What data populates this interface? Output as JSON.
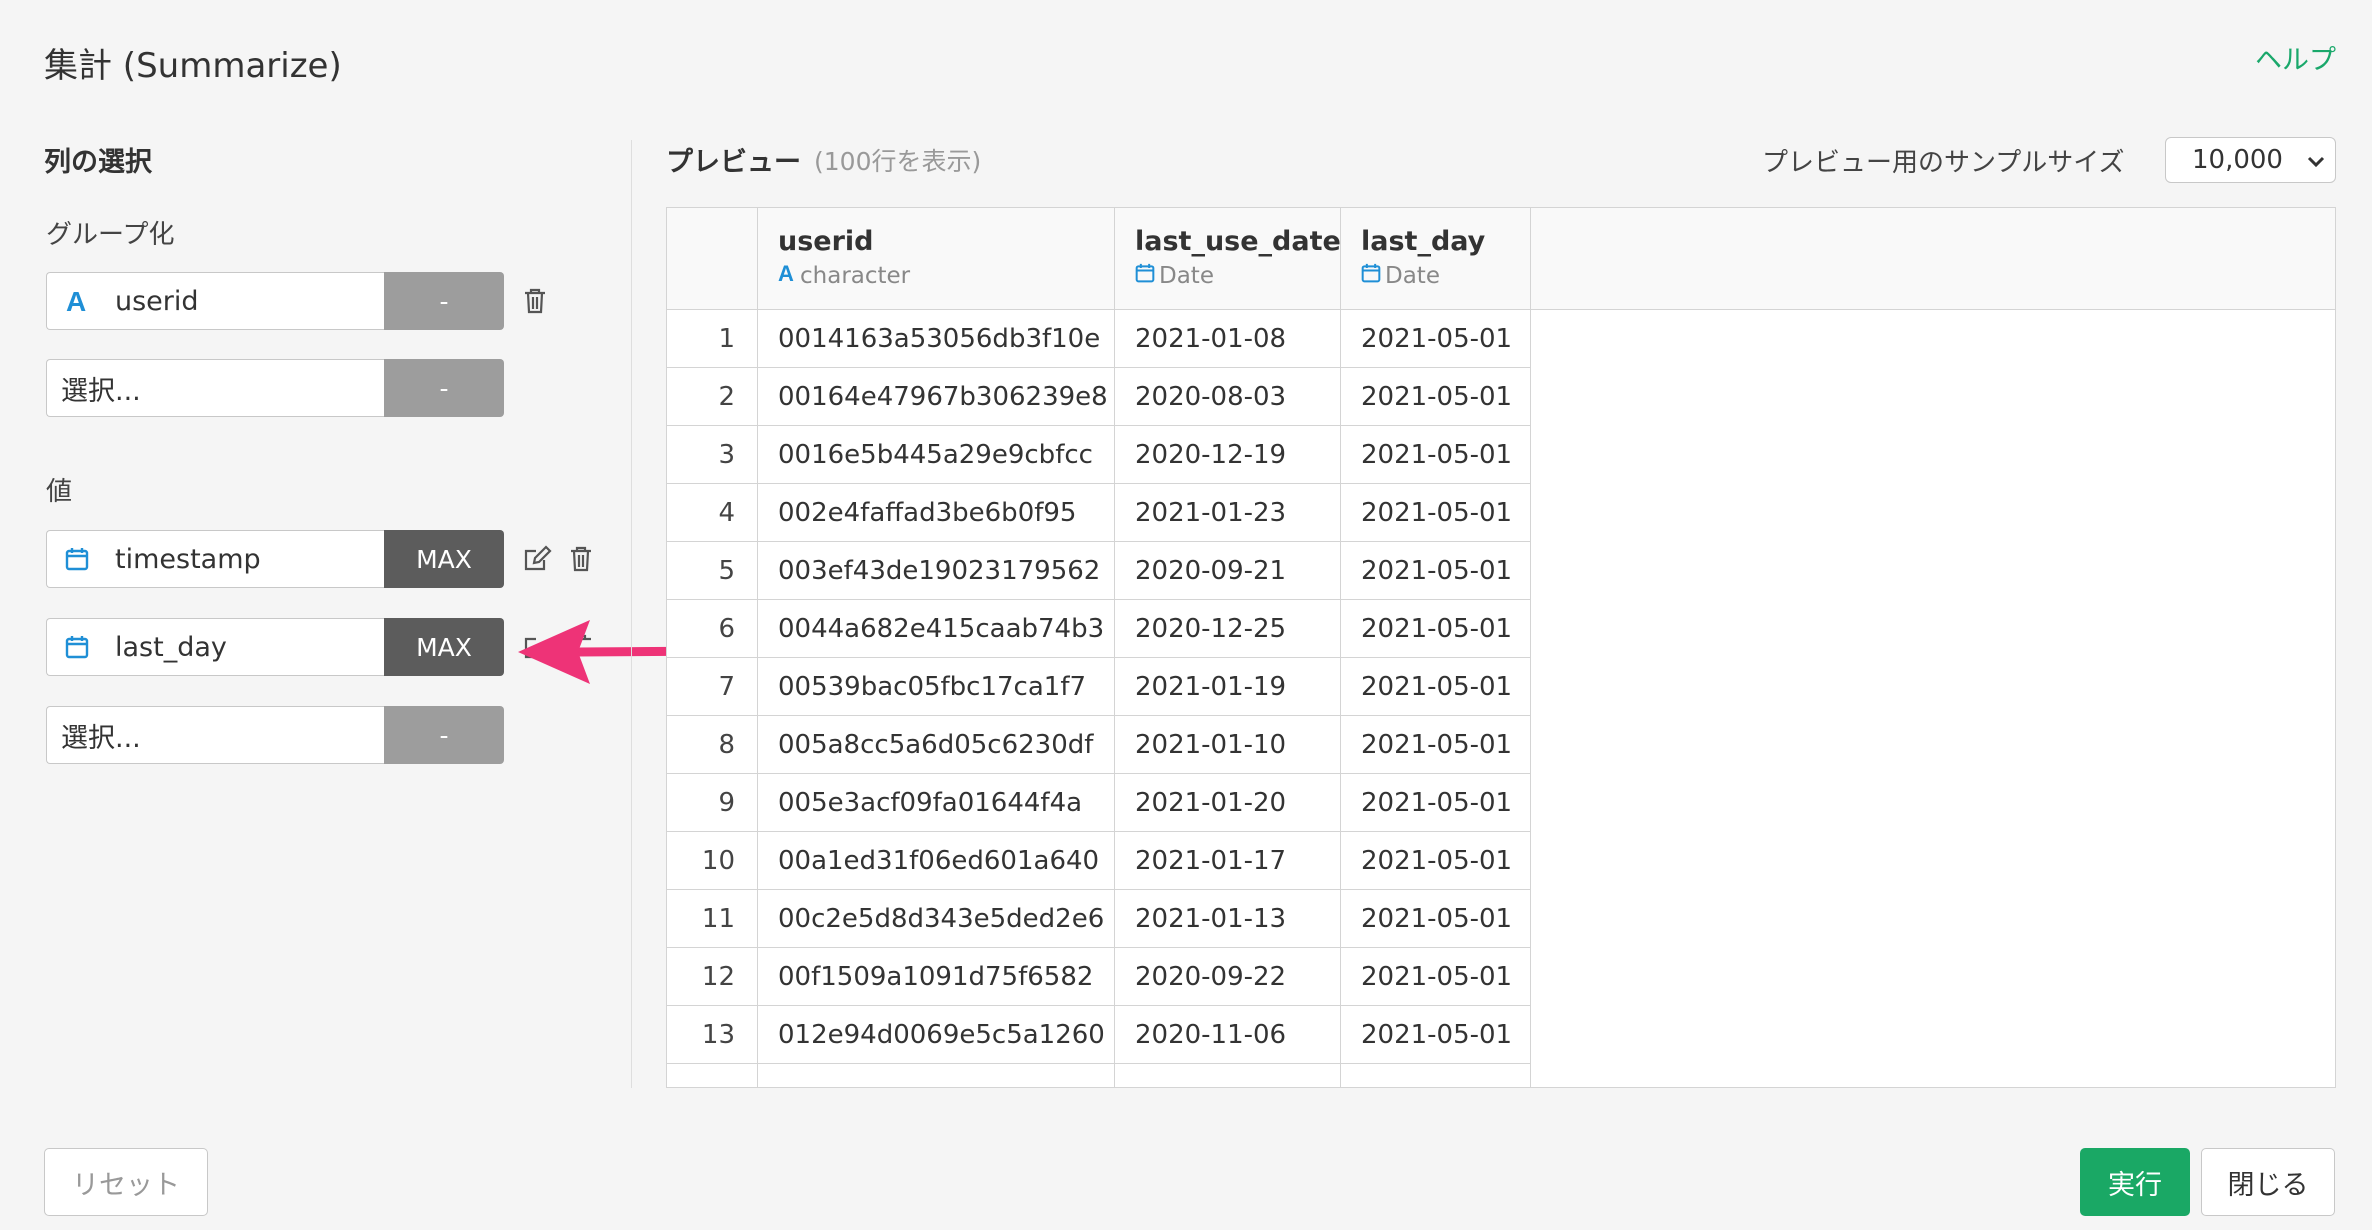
{
  "header": {
    "title": "集計 (Summarize)",
    "help_label": "ヘルプ"
  },
  "column_selection": {
    "heading": "列の選択",
    "group_label": "グループ化",
    "group_rows": [
      {
        "field": "userid",
        "icon": "character-type-icon",
        "agg": "-"
      },
      {
        "field": "選択...",
        "agg": "-"
      }
    ],
    "values_label": "値",
    "value_rows": [
      {
        "field": "timestamp",
        "icon": "calendar-icon",
        "agg": "MAX"
      },
      {
        "field": "last_day",
        "icon": "calendar-icon",
        "agg": "MAX"
      },
      {
        "field": "選択...",
        "agg": "-"
      }
    ]
  },
  "preview": {
    "title": "プレビュー",
    "subtitle": "(100行を表示)",
    "sample_size_label": "プレビュー用のサンプルサイズ",
    "sample_size_value": "10,000",
    "columns": [
      {
        "name": "userid",
        "type": "character"
      },
      {
        "name": "last_use_date",
        "type": "Date"
      },
      {
        "name": "last_day",
        "type": "Date"
      }
    ],
    "rows": [
      {
        "n": "1",
        "userid": "0014163a53056db3f10e",
        "last_use_date": "2021-01-08",
        "last_day": "2021-05-01"
      },
      {
        "n": "2",
        "userid": "00164e47967b306239e8",
        "last_use_date": "2020-08-03",
        "last_day": "2021-05-01"
      },
      {
        "n": "3",
        "userid": "0016e5b445a29e9cbfcc",
        "last_use_date": "2020-12-19",
        "last_day": "2021-05-01"
      },
      {
        "n": "4",
        "userid": "002e4faffad3be6b0f95",
        "last_use_date": "2021-01-23",
        "last_day": "2021-05-01"
      },
      {
        "n": "5",
        "userid": "003ef43de19023179562",
        "last_use_date": "2020-09-21",
        "last_day": "2021-05-01"
      },
      {
        "n": "6",
        "userid": "0044a682e415caab74b3",
        "last_use_date": "2020-12-25",
        "last_day": "2021-05-01"
      },
      {
        "n": "7",
        "userid": "00539bac05fbc17ca1f7",
        "last_use_date": "2021-01-19",
        "last_day": "2021-05-01"
      },
      {
        "n": "8",
        "userid": "005a8cc5a6d05c6230df",
        "last_use_date": "2021-01-10",
        "last_day": "2021-05-01"
      },
      {
        "n": "9",
        "userid": "005e3acf09fa01644f4a",
        "last_use_date": "2021-01-20",
        "last_day": "2021-05-01"
      },
      {
        "n": "10",
        "userid": "00a1ed31f06ed601a640",
        "last_use_date": "2021-01-17",
        "last_day": "2021-05-01"
      },
      {
        "n": "11",
        "userid": "00c2e5d8d343e5ded2e6",
        "last_use_date": "2021-01-13",
        "last_day": "2021-05-01"
      },
      {
        "n": "12",
        "userid": "00f1509a1091d75f6582",
        "last_use_date": "2020-09-22",
        "last_day": "2021-05-01"
      },
      {
        "n": "13",
        "userid": "012e94d0069e5c5a1260",
        "last_use_date": "2020-11-06",
        "last_day": "2021-05-01"
      }
    ]
  },
  "footer": {
    "reset_label": "リセット",
    "run_label": "実行",
    "close_label": "閉じる"
  },
  "colors": {
    "accent_green": "#1aa865",
    "arrow_pink": "#ee3377",
    "icon_blue": "#1f8fd6"
  }
}
